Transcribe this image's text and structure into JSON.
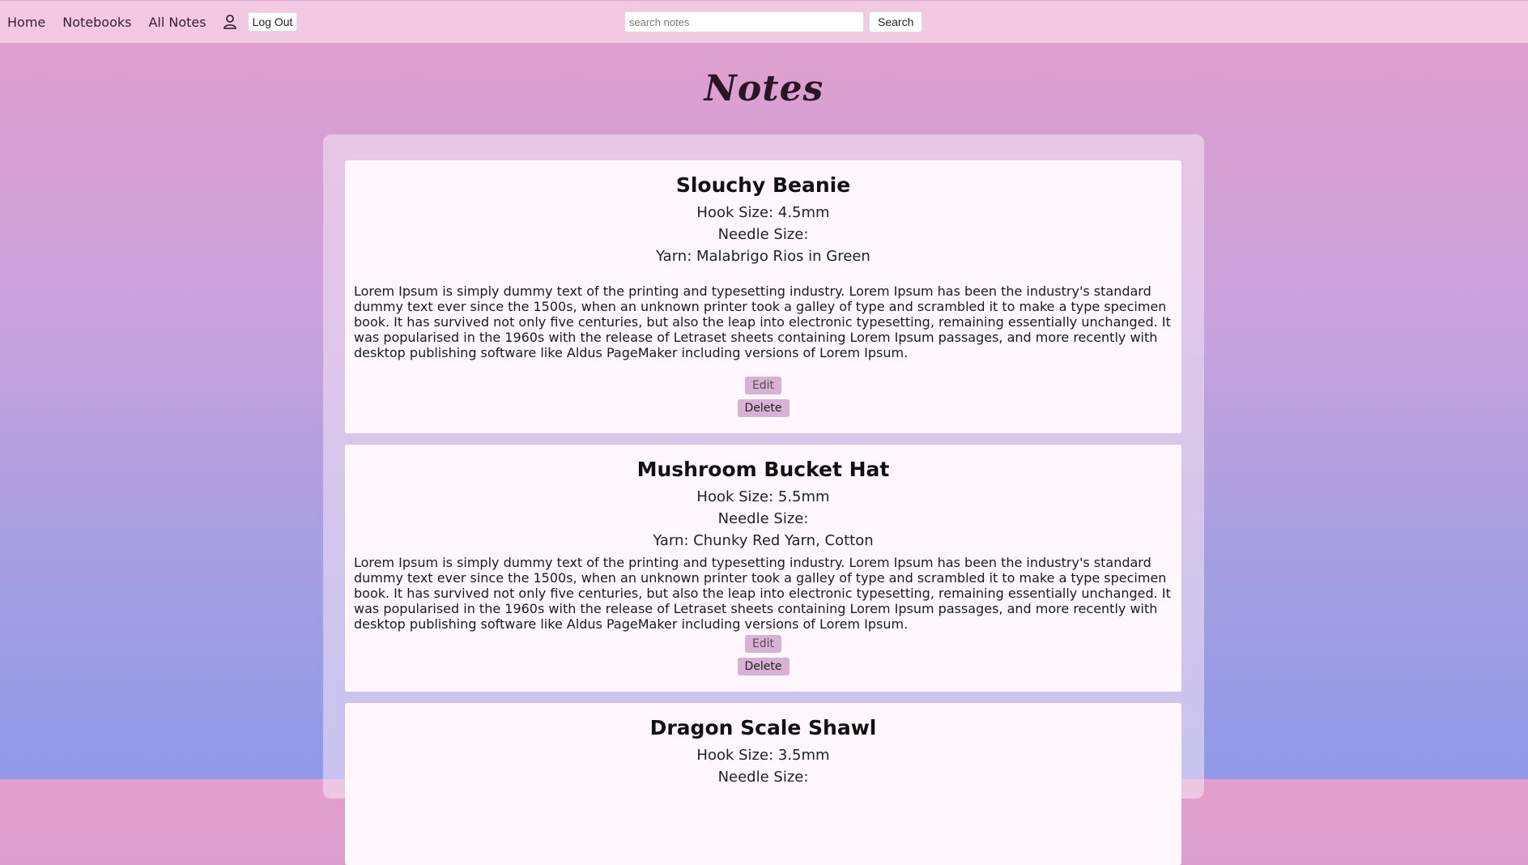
{
  "nav": {
    "home": "Home",
    "notebooks": "Notebooks",
    "all_notes": "All Notes",
    "logout": "Log Out"
  },
  "search": {
    "placeholder": "search notes",
    "button": "Search"
  },
  "page_title": "Notes",
  "notes": [
    {
      "title": "Slouchy Beanie",
      "hook": "Hook Size: 4.5mm",
      "needle": "Needle Size:",
      "yarn": "Yarn: Malabrigo Rios in Green",
      "body": "Lorem Ipsum is simply dummy text of the printing and typesetting industry. Lorem Ipsum has been the industry's standard dummy text ever since the 1500s, when an unknown printer took a galley of type and scrambled it to make a type specimen book. It has survived not only five centuries, but also the leap into electronic typesetting, remaining essentially unchanged. It was popularised in the 1960s with the release of Letraset sheets containing Lorem Ipsum passages, and more recently with desktop publishing software like Aldus PageMaker including versions of Lorem Ipsum.",
      "edit": "Edit",
      "delete": "Delete"
    },
    {
      "title": "Mushroom Bucket Hat",
      "hook": "Hook Size: 5.5mm",
      "needle": "Needle Size:",
      "yarn": "Yarn: Chunky Red Yarn, Cotton",
      "body": "Lorem Ipsum is simply dummy text of the printing and typesetting industry. Lorem Ipsum has been the industry's standard dummy text ever since the 1500s, when an unknown printer took a galley of type and scrambled it to make a type specimen book. It has survived not only five centuries, but also the leap into electronic typesetting, remaining essentially unchanged. It was popularised in the 1960s with the release of Letraset sheets containing Lorem Ipsum passages, and more recently with desktop publishing software like Aldus PageMaker including versions of Lorem Ipsum.",
      "edit": "Edit",
      "delete": "Delete"
    },
    {
      "title": "Dragon Scale Shawl",
      "hook": "Hook Size: 3.5mm",
      "needle": "Needle Size:"
    }
  ]
}
